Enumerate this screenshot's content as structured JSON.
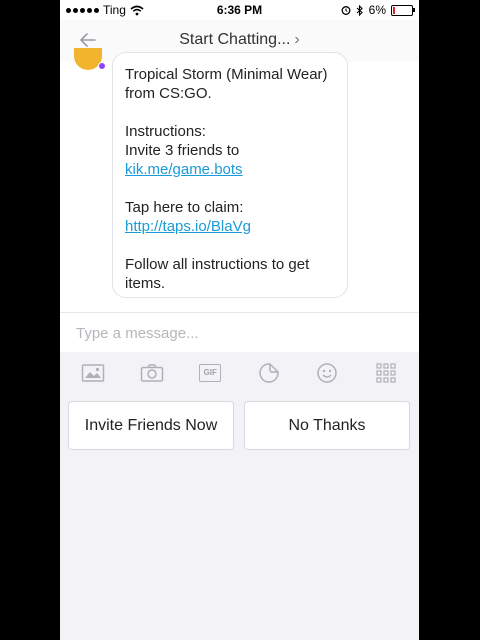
{
  "status_bar": {
    "carrier": "Ting",
    "time": "6:36 PM",
    "battery": "6%"
  },
  "nav": {
    "title": "Start Chatting...",
    "chevron": "›"
  },
  "message": {
    "line1": "Tropical Storm (Minimal Wear)",
    "line2": "from CS:GO.",
    "instructions_label": "Instructions:",
    "instructions_text": "Invite 3 friends to",
    "invite_link": "kik.me/game.bots",
    "claim_text": "Tap here to claim:",
    "claim_link": "http://taps.io/BlaVg",
    "follow_line1": "Follow all instructions to get",
    "follow_line2": "items."
  },
  "composer": {
    "placeholder": "Type a message...",
    "gif_label": "GIF"
  },
  "icons": [
    "back-arrow-icon",
    "chevron-right-icon",
    "gallery-icon",
    "camera-icon",
    "gif-icon",
    "sticker-icon",
    "smiley-icon",
    "grid-icon",
    "wifi-icon",
    "alarm-icon",
    "bluetooth-icon",
    "battery-icon"
  ],
  "colors": {
    "link": "#1a9bd7",
    "battery_low": "#e0202a",
    "avatar": "#f1b42c",
    "online_dot": "#8e44ff"
  },
  "suggested_responses": {
    "left": "Invite Friends Now",
    "right": "No Thanks"
  }
}
